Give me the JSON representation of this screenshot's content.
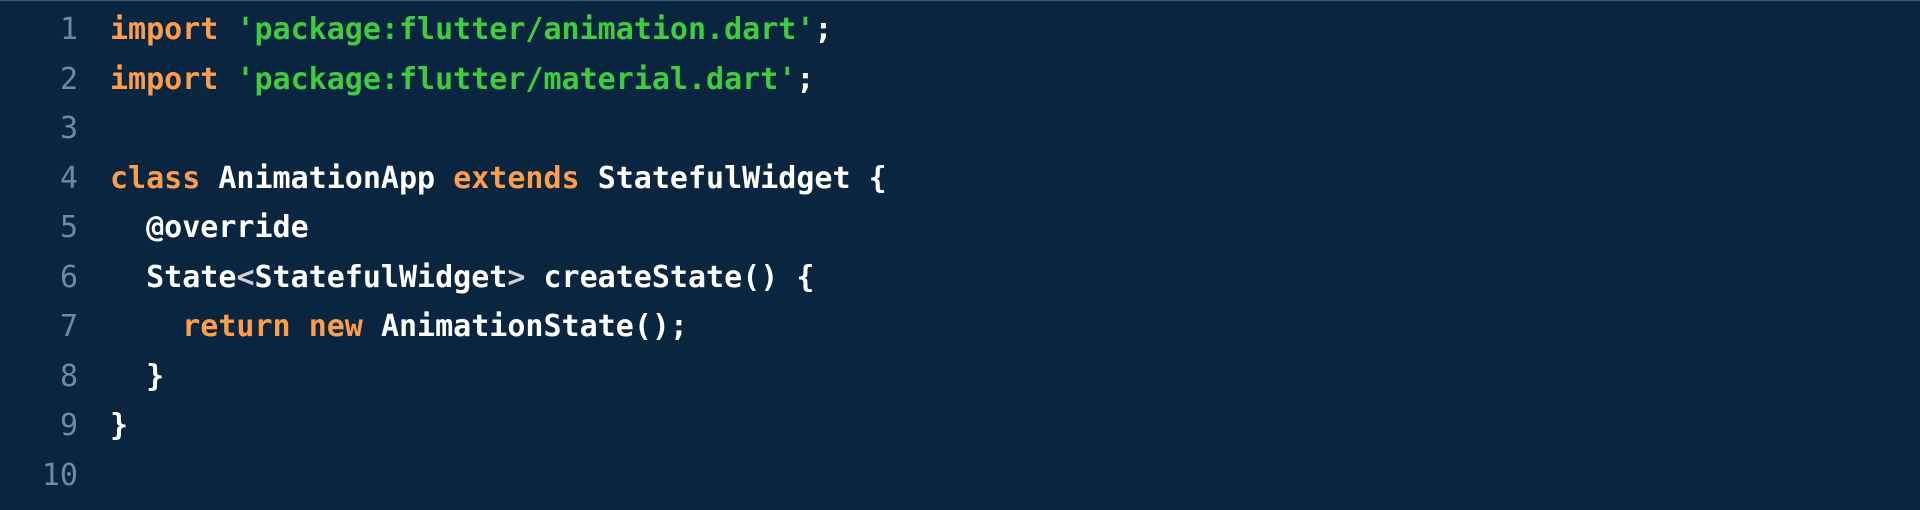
{
  "gutter": {
    "lines": [
      "1",
      "2",
      "3",
      "4",
      "5",
      "6",
      "7",
      "8",
      "9",
      "10"
    ],
    "foldable": [
      false,
      false,
      false,
      true,
      false,
      true,
      false,
      false,
      false,
      false
    ]
  },
  "code": {
    "lines": [
      {
        "indent": 0,
        "tokens": [
          {
            "cls": "tok-keyword",
            "t": "import"
          },
          {
            "cls": "tok-punct",
            "t": " "
          },
          {
            "cls": "tok-string",
            "t": "'package:flutter/animation.dart'"
          },
          {
            "cls": "tok-punct",
            "t": ";"
          }
        ]
      },
      {
        "indent": 0,
        "tokens": [
          {
            "cls": "tok-keyword",
            "t": "import"
          },
          {
            "cls": "tok-punct",
            "t": " "
          },
          {
            "cls": "tok-string",
            "t": "'package:flutter/material.dart'"
          },
          {
            "cls": "tok-punct",
            "t": ";"
          }
        ]
      },
      {
        "indent": 0,
        "tokens": []
      },
      {
        "indent": 0,
        "tokens": [
          {
            "cls": "tok-keyword",
            "t": "class"
          },
          {
            "cls": "tok-punct",
            "t": " "
          },
          {
            "cls": "tok-class",
            "t": "AnimationApp"
          },
          {
            "cls": "tok-punct",
            "t": " "
          },
          {
            "cls": "tok-keyword",
            "t": "extends"
          },
          {
            "cls": "tok-punct",
            "t": " "
          },
          {
            "cls": "tok-type",
            "t": "StatefulWidget"
          },
          {
            "cls": "tok-punct",
            "t": " {"
          }
        ]
      },
      {
        "indent": 1,
        "tokens": [
          {
            "cls": "tok-annot",
            "t": "@override"
          }
        ]
      },
      {
        "indent": 1,
        "tokens": [
          {
            "cls": "tok-type",
            "t": "State"
          },
          {
            "cls": "tok-angle",
            "t": "<"
          },
          {
            "cls": "tok-type",
            "t": "StatefulWidget"
          },
          {
            "cls": "tok-angle",
            "t": ">"
          },
          {
            "cls": "tok-punct",
            "t": " "
          },
          {
            "cls": "tok-ident",
            "t": "createState"
          },
          {
            "cls": "tok-punct",
            "t": "() {"
          }
        ]
      },
      {
        "indent": 2,
        "tokens": [
          {
            "cls": "tok-keyword",
            "t": "return"
          },
          {
            "cls": "tok-punct",
            "t": " "
          },
          {
            "cls": "tok-keyword",
            "t": "new"
          },
          {
            "cls": "tok-punct",
            "t": " "
          },
          {
            "cls": "tok-type",
            "t": "AnimationState"
          },
          {
            "cls": "tok-punct",
            "t": "();"
          }
        ]
      },
      {
        "indent": 1,
        "tokens": [
          {
            "cls": "tok-punct",
            "t": "}"
          }
        ]
      },
      {
        "indent": 0,
        "tokens": [
          {
            "cls": "tok-punct",
            "t": "}"
          }
        ]
      },
      {
        "indent": 0,
        "tokens": []
      }
    ]
  }
}
